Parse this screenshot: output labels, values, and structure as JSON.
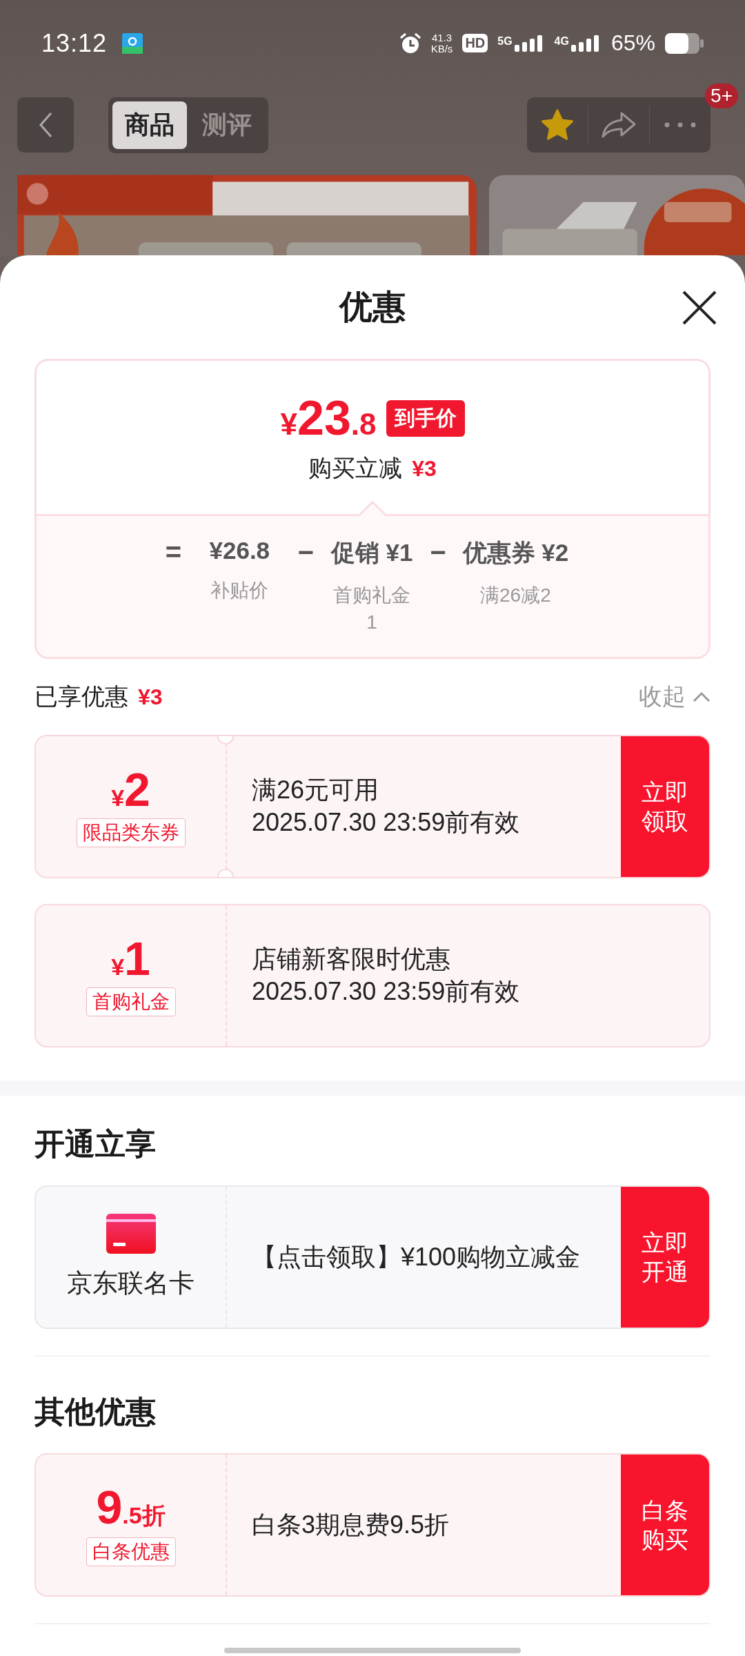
{
  "status_bar": {
    "time": "13:12",
    "speed": "41.3",
    "speed_unit": "KB/s",
    "hd": "HD",
    "sim1": "5G",
    "sim2": "4G",
    "battery": "65%"
  },
  "nav": {
    "tabs": [
      {
        "label": "商品",
        "selected": true
      },
      {
        "label": "测评",
        "selected": false
      }
    ],
    "favorited": true,
    "badge": "5+"
  },
  "sheet": {
    "title": "优惠"
  },
  "price": {
    "currency": "¥",
    "integer": "23",
    "decimal": ".8",
    "tag": "到手价",
    "saving_label": "购买立减",
    "saving": "¥3",
    "breakdown": [
      {
        "kind": "operator",
        "text": "="
      },
      {
        "kind": "term",
        "value": "¥26.8",
        "note": "补贴价"
      },
      {
        "kind": "operator",
        "text": "−"
      },
      {
        "kind": "term",
        "value": "促销 ¥1",
        "note": "首购礼金1"
      },
      {
        "kind": "operator",
        "text": "−"
      },
      {
        "kind": "term",
        "value": "优惠券 ¥2",
        "note": "满26减2"
      }
    ]
  },
  "enjoyed": {
    "label": "已享优惠",
    "amount": "¥3",
    "toggle": "收起",
    "expanded": true
  },
  "coupons": [
    {
      "kind": "ticket",
      "currency": "¥",
      "amount": "2",
      "tag": "限品类东券",
      "title": "满26元可用",
      "validity": "2025.07.30 23:59前有效",
      "action": "立即领取"
    },
    {
      "kind": "amount",
      "currency": "¥",
      "amount": "1",
      "tag": "首购礼金",
      "title": "店铺新客限时优惠",
      "validity": "2025.07.30 23:59前有效"
    }
  ],
  "open_section": {
    "title": "开通立享",
    "cards": [
      {
        "kind": "card",
        "name": "京东联名卡",
        "title": "【点击领取】¥100购物立减金",
        "action": "立即开通"
      }
    ]
  },
  "other_section": {
    "title": "其他优惠",
    "cards": [
      {
        "kind": "discount",
        "big": "9",
        "small": ".5折",
        "tag": "白条优惠",
        "title": "白条3期息费9.5折",
        "action": "白条购买"
      }
    ]
  }
}
